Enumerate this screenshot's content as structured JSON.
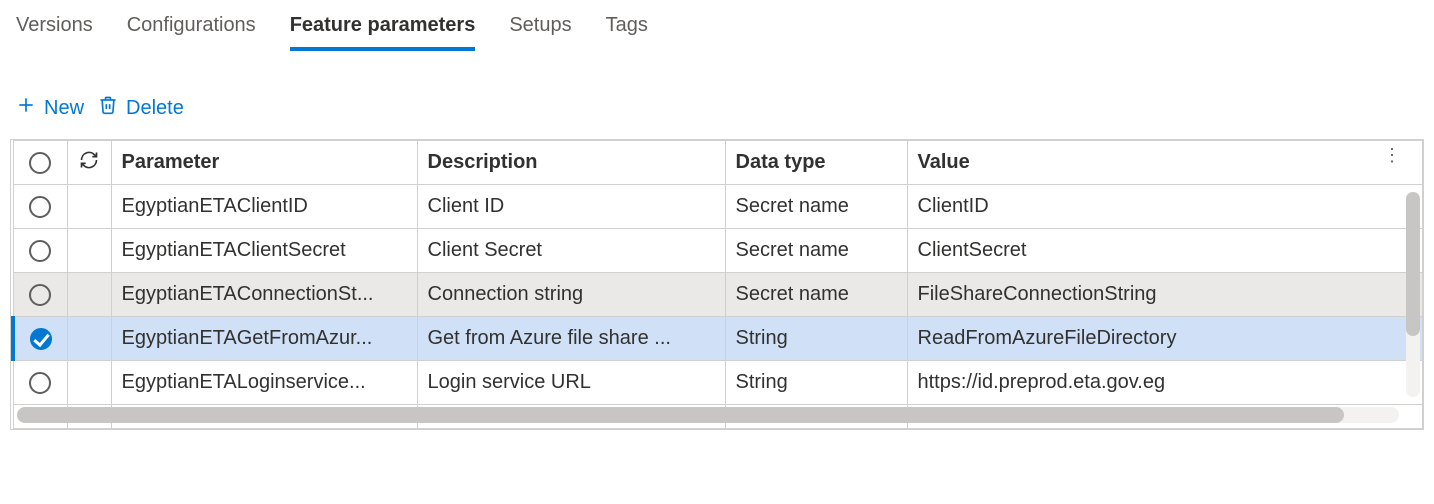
{
  "tabs": {
    "versions": "Versions",
    "configurations": "Configurations",
    "feature_parameters": "Feature parameters",
    "setups": "Setups",
    "tags": "Tags",
    "active": "feature_parameters"
  },
  "toolbar": {
    "new_label": "New",
    "delete_label": "Delete"
  },
  "grid": {
    "columns": {
      "parameter": "Parameter",
      "description": "Description",
      "data_type": "Data type",
      "value": "Value"
    },
    "rows": [
      {
        "selected": false,
        "hovered": false,
        "parameter": "EgyptianETAClientID",
        "description": "Client ID",
        "data_type": "Secret name",
        "value": "ClientID"
      },
      {
        "selected": false,
        "hovered": false,
        "parameter": "EgyptianETAClientSecret",
        "description": "Client Secret",
        "data_type": "Secret name",
        "value": "ClientSecret"
      },
      {
        "selected": false,
        "hovered": true,
        "parameter": "EgyptianETAConnectionSt...",
        "description": "Connection string",
        "data_type": "Secret name",
        "value": "FileShareConnectionString"
      },
      {
        "selected": true,
        "hovered": false,
        "parameter": "EgyptianETAGetFromAzur...",
        "description": "Get from Azure file share ...",
        "data_type": "String",
        "value": "ReadFromAzureFileDirectory"
      },
      {
        "selected": false,
        "hovered": false,
        "parameter": "EgyptianETALoginservice...",
        "description": "Login service URL",
        "data_type": "String",
        "value": "https://id.preprod.eta.gov.eg"
      }
    ]
  }
}
